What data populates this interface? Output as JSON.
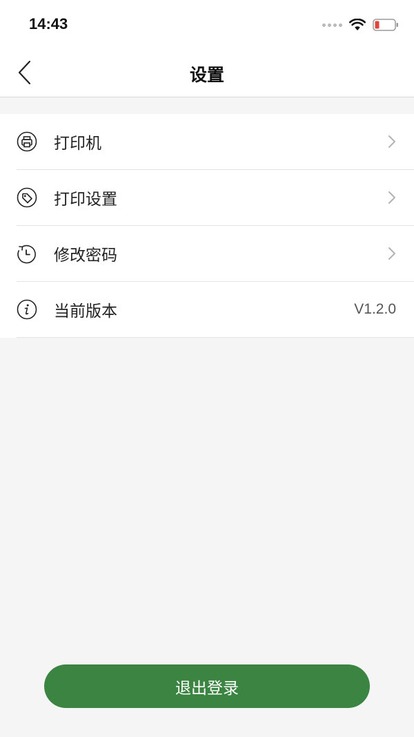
{
  "status_bar": {
    "time": "14:43",
    "icons": [
      "signal-dots-icon",
      "wifi-icon",
      "battery-low-icon"
    ],
    "battery_color": "#e0453a"
  },
  "nav": {
    "title": "设置",
    "back_icon": "chevron-left-icon"
  },
  "settings": {
    "items": [
      {
        "label": "打印机",
        "icon": "printer-icon",
        "has_chevron": true
      },
      {
        "label": "打印设置",
        "icon": "tag-icon",
        "has_chevron": true
      },
      {
        "label": "修改密码",
        "icon": "clock-reset-icon",
        "has_chevron": true
      },
      {
        "label": "当前版本",
        "icon": "info-icon",
        "value": "V1.2.0"
      }
    ]
  },
  "logout": {
    "label": "退出登录",
    "color": "#3b8442"
  }
}
